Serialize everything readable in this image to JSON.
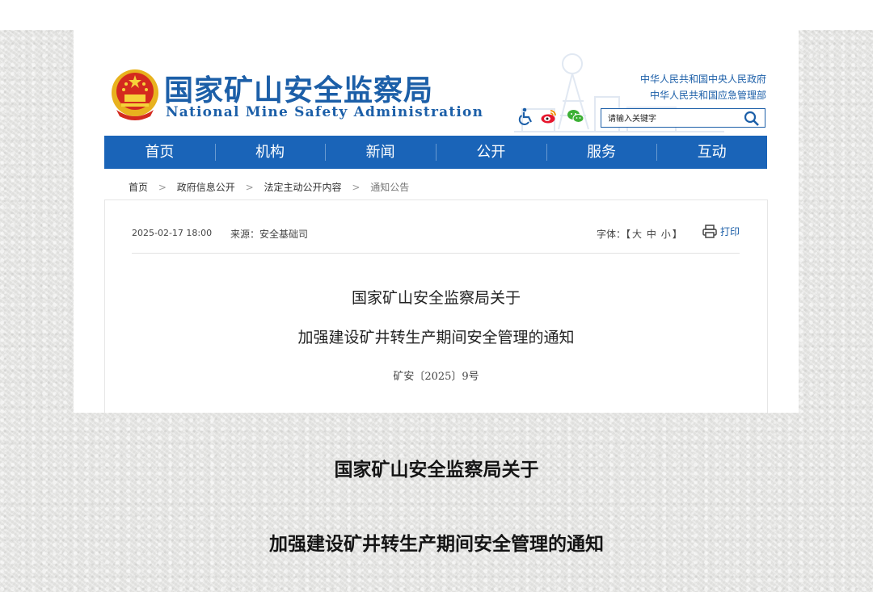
{
  "header": {
    "site_title_cn": "国家矿山安全监察局",
    "site_title_en": "National Mine Safety Administration",
    "gov_links": [
      "中华人民共和国中央人民政府",
      "中华人民共和国应急管理部"
    ],
    "icons": [
      "accessibility-icon",
      "weibo-icon",
      "wechat-icon"
    ],
    "search": {
      "placeholder": "请输入关键字"
    },
    "brand_color": "#1c5fa8"
  },
  "nav": {
    "items": [
      "首页",
      "机构",
      "新闻",
      "公开",
      "服务",
      "互动"
    ],
    "bg_color": "#1a64b8"
  },
  "breadcrumb": {
    "items": [
      "首页",
      "政府信息公开",
      "法定主动公开内容",
      "通知公告"
    ],
    "separator": ">"
  },
  "article": {
    "date": "2025-02-17 18:00",
    "source": "来源：安全基础司",
    "font_size_label": "字体：【",
    "font_sizes": [
      "大",
      "中",
      "小"
    ],
    "font_size_end": "】",
    "print_label": "打印",
    "title_line1": "国家矿山安全监察局关于",
    "title_line2": "加强建设矿井转生产期间安全管理的通知",
    "doc_number": "矿安〔2025〕9号"
  },
  "caption": {
    "line1": "国家矿山安全监察局关于",
    "line2": "加强建设矿井转生产期间安全管理的通知"
  }
}
